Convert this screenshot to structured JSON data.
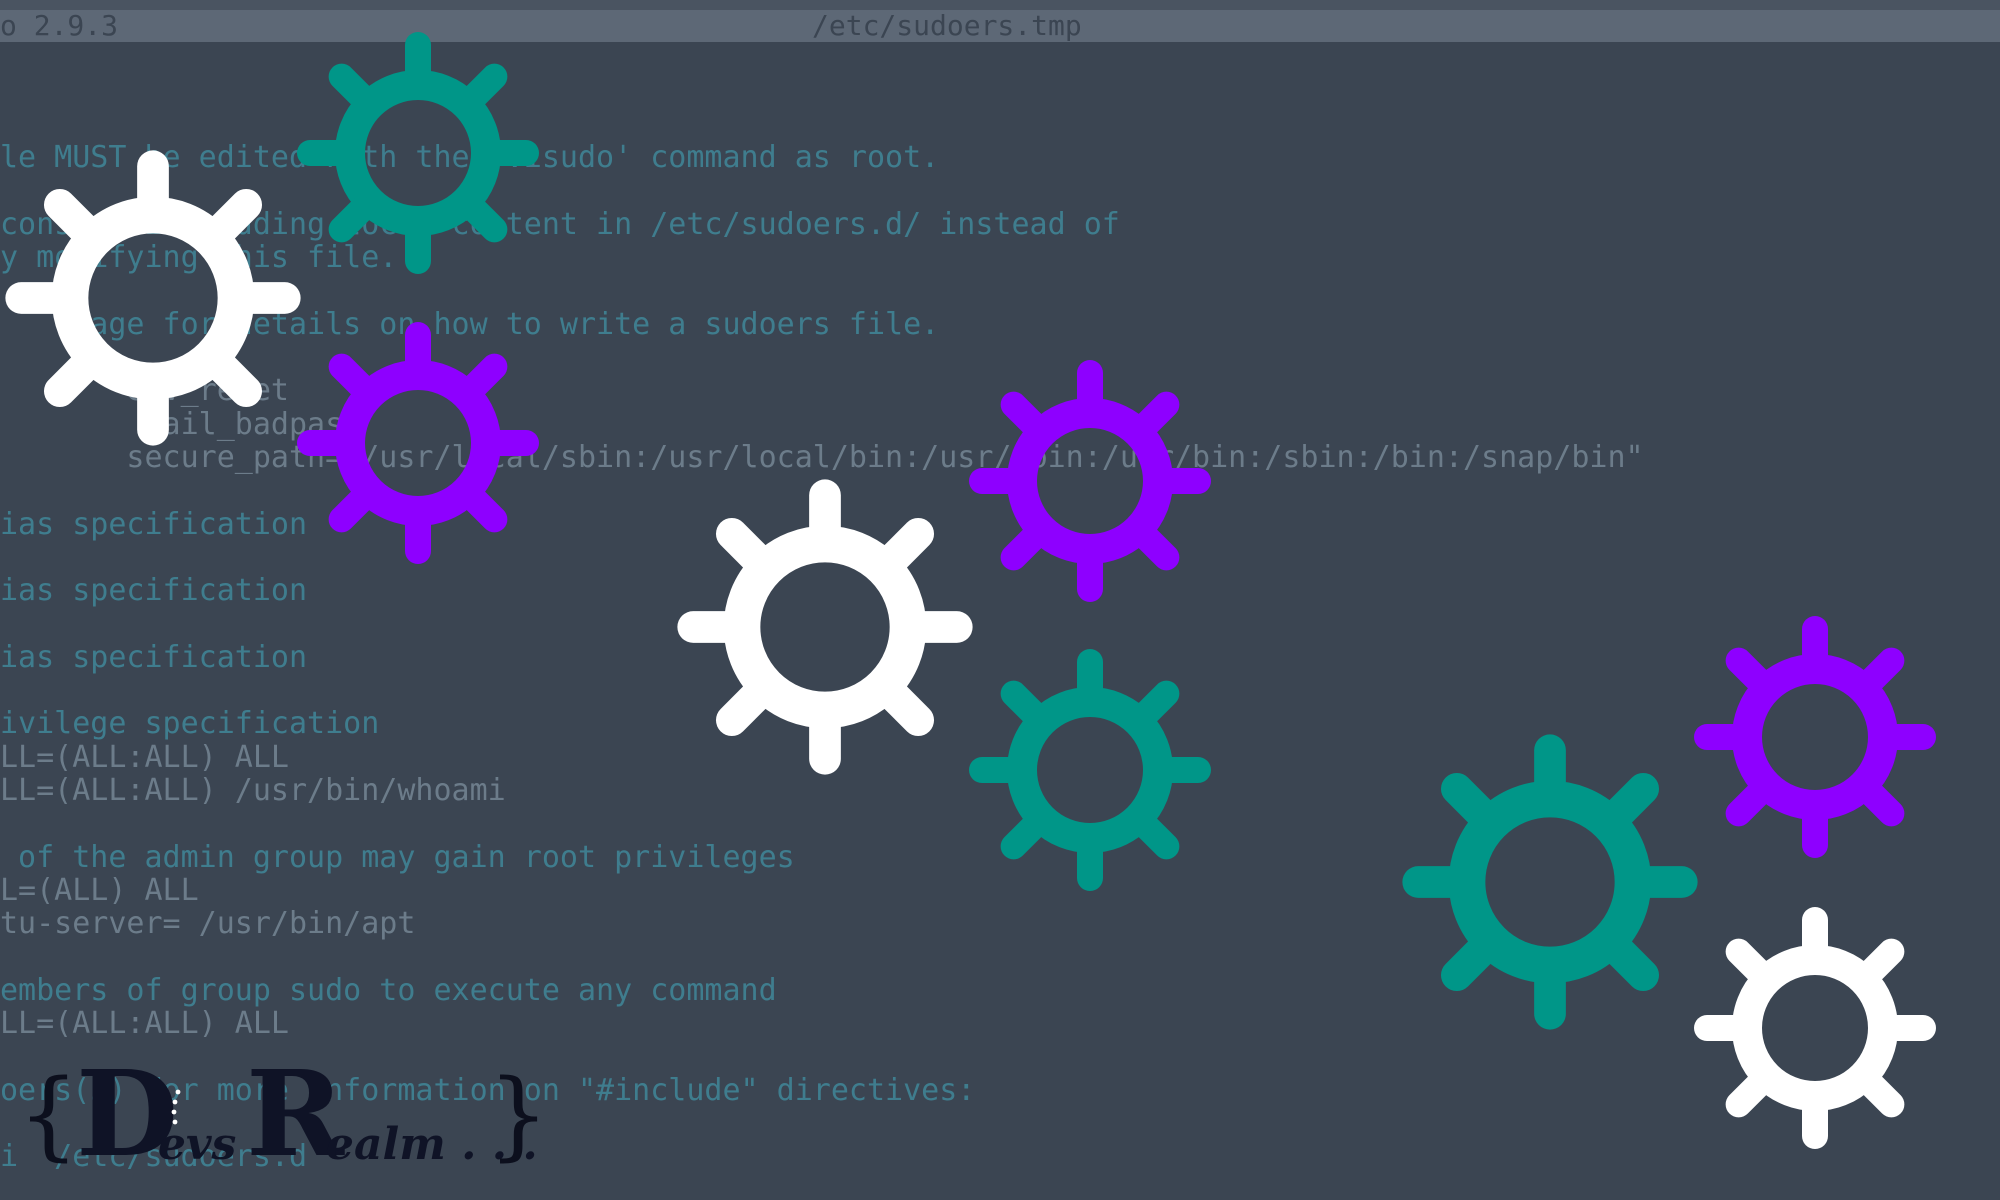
{
  "title_bar": {
    "app": "o 2.9.3",
    "file": "/etc/sudoers.tmp"
  },
  "editor_lines": [
    {
      "text": "",
      "kind": "comment"
    },
    {
      "text": "le MUST be edited with the 'visudo' command as root.",
      "kind": "comment"
    },
    {
      "text": "",
      "kind": "comment"
    },
    {
      "text": "considering adding local content in /etc/sudoers.d/ instead of",
      "kind": "comment"
    },
    {
      "text": "y modifying this file.",
      "kind": "comment"
    },
    {
      "text": "",
      "kind": "comment"
    },
    {
      "text": "    page for details on how to write a sudoers file.",
      "kind": "comment"
    },
    {
      "text": "",
      "kind": "comment"
    },
    {
      "text": "       env_reset",
      "kind": "code"
    },
    {
      "text": "        mail_badpass",
      "kind": "code"
    },
    {
      "text": "       secure_path=\"/usr/local/sbin:/usr/local/bin:/usr/sbin:/usr/bin:/sbin:/bin:/snap/bin\"",
      "kind": "code"
    },
    {
      "text": "",
      "kind": "comment"
    },
    {
      "text": "ias specification",
      "kind": "comment"
    },
    {
      "text": "",
      "kind": "comment"
    },
    {
      "text": "ias specification",
      "kind": "comment"
    },
    {
      "text": "",
      "kind": "comment"
    },
    {
      "text": "ias specification",
      "kind": "comment"
    },
    {
      "text": "",
      "kind": "comment"
    },
    {
      "text": "ivilege specification",
      "kind": "comment"
    },
    {
      "text": "LL=(ALL:ALL) ALL",
      "kind": "code"
    },
    {
      "text": "LL=(ALL:ALL) /usr/bin/whoami",
      "kind": "code"
    },
    {
      "text": "",
      "kind": "comment"
    },
    {
      "text": " of the admin group may gain root privileges",
      "kind": "comment"
    },
    {
      "text": "L=(ALL) ALL",
      "kind": "code"
    },
    {
      "text": "tu-server= /usr/bin/apt",
      "kind": "code"
    },
    {
      "text": "",
      "kind": "comment"
    },
    {
      "text": "embers of group sudo to execute any command",
      "kind": "comment"
    },
    {
      "text": "LL=(ALL:ALL) ALL",
      "kind": "code"
    },
    {
      "text": "",
      "kind": "comment"
    },
    {
      "text": "oers(5) for more information on \"#include\" directives:",
      "kind": "comment"
    },
    {
      "text": "",
      "kind": "comment"
    },
    {
      "text": "i  /etc/sudoers.d",
      "kind": "comment"
    }
  ],
  "logo": {
    "brace_left": "{",
    "letter_d": "D",
    "rest_d": "evs",
    "letter_r": "R",
    "rest_r": "ealm . . .",
    "brace_right": "}"
  },
  "colors": {
    "background": "#3b4552",
    "gear_teal": "#009688",
    "gear_white": "#ffffff",
    "gear_purple": "#8e00ff"
  },
  "gears": [
    {
      "color": "gear_teal",
      "icon": "gear-icon"
    },
    {
      "color": "gear_white",
      "icon": "gear-icon"
    },
    {
      "color": "gear_purple",
      "icon": "gear-icon"
    },
    {
      "color": "gear_purple",
      "icon": "gear-icon"
    },
    {
      "color": "gear_white",
      "icon": "gear-icon"
    },
    {
      "color": "gear_teal",
      "icon": "gear-icon"
    },
    {
      "color": "gear_purple",
      "icon": "gear-icon"
    },
    {
      "color": "gear_teal",
      "icon": "gear-icon"
    },
    {
      "color": "gear_white",
      "icon": "gear-icon"
    }
  ]
}
